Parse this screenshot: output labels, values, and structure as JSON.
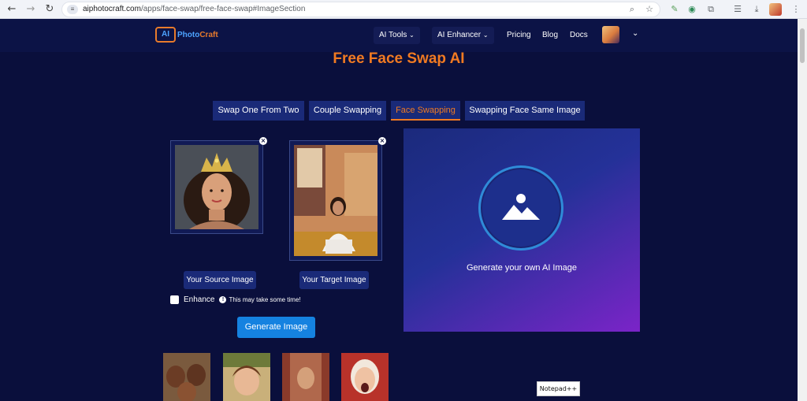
{
  "browser": {
    "url_host": "aiphotocraft.com",
    "url_path": "/apps/face-swap/free-face-swap#ImageSection",
    "back_icon": "arrow-left-icon",
    "forward_icon": "arrow-right-icon",
    "reload_icon": "reload-icon"
  },
  "nav": {
    "logo_ai": "AI",
    "logo_photo": "Photo",
    "logo_craft": "Craft",
    "items": [
      {
        "label": "AI Tools",
        "dropdown": true
      },
      {
        "label": "AI Enhancer",
        "dropdown": true
      },
      {
        "label": "Pricing",
        "dropdown": false
      },
      {
        "label": "Blog",
        "dropdown": false
      },
      {
        "label": "Docs",
        "dropdown": false
      }
    ]
  },
  "page": {
    "title": "Free Face Swap AI",
    "tabs": [
      {
        "label": "Swap One From Two",
        "active": false
      },
      {
        "label": "Couple Swapping",
        "active": false
      },
      {
        "label": "Face Swapping",
        "active": true
      },
      {
        "label": "Swapping Face Same Image",
        "active": false
      }
    ],
    "source_label": "Your Source Image",
    "target_label": "Your Target Image",
    "enhance_label": "Enhance",
    "enhance_note": "This may take some time!",
    "generate_label": "Generate Image",
    "preview_text": "Generate your own AI Image"
  },
  "tooltip": "Notepad++",
  "colors": {
    "accent": "#f07a22",
    "primary_button": "#1582e0",
    "page_bg": "#0a0f3c"
  }
}
